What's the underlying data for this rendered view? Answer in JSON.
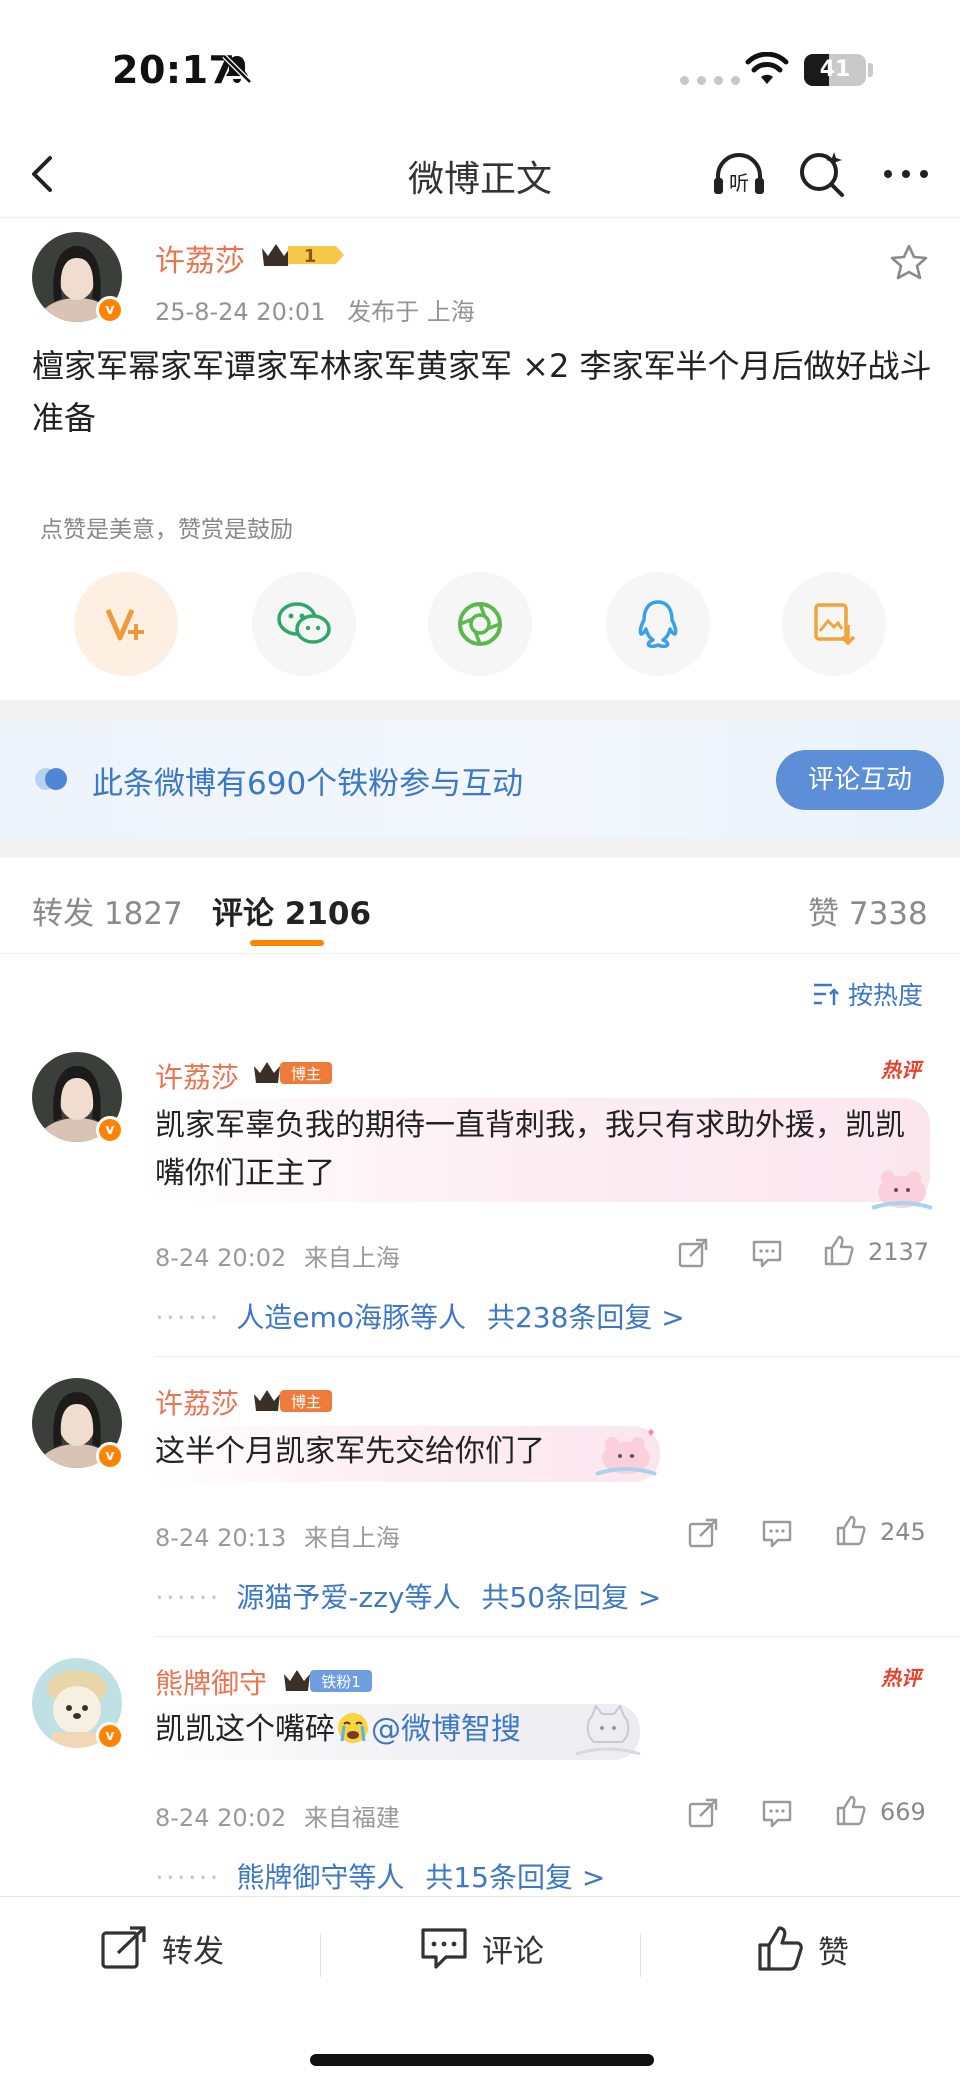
{
  "status_bar": {
    "time": "20:17",
    "battery": "41",
    "battery_level": 0.41
  },
  "nav": {
    "title": "微博正文"
  },
  "post": {
    "author": "许荔莎",
    "level": "1",
    "date": "25-8-24 20:01",
    "location": "发布于 上海",
    "text": "檀家军幂家军谭家军林家军黄家军 ×2 李家军半个月后做好战斗准备",
    "reward_hint": "点赞是美意，赞赏是鼓励"
  },
  "fans_banner": {
    "text": "此条微博有690个铁粉参与互动",
    "button": "评论互动"
  },
  "tabs": {
    "repost_label": "转发",
    "repost_count": "1827",
    "comment_label": "评论",
    "comment_count": "2106",
    "like_label": "赞",
    "like_count": "7338"
  },
  "sort": {
    "label": "按热度"
  },
  "comments": [
    {
      "author": "许荔莎",
      "badge": "博主",
      "hot": "热评",
      "text": "凯家军辜负我的期待一直背刺我，我只有求助外援，凯凯嘴你们正主了",
      "time": "8-24 20:02",
      "location": "来自上海",
      "likes": "2137",
      "replies_leader": "人造emo海豚等人",
      "replies_count": "共238条回复 >"
    },
    {
      "author": "许荔莎",
      "badge": "博主",
      "text": "这半个月凯家军先交给你们了",
      "time": "8-24 20:13",
      "location": "来自上海",
      "likes": "245",
      "replies_leader": "源猫予爱-zzy等人",
      "replies_count": "共50条回复 >"
    },
    {
      "author": "熊牌御守",
      "badge": "铁粉1",
      "hot": "热评",
      "text": "凯凯这个嘴碎",
      "mention": "@微博智搜",
      "time": "8-24 20:02",
      "location": "来自福建",
      "likes": "669",
      "replies_leader": "熊牌御守等人",
      "replies_count": "共15条回复 >"
    }
  ],
  "bottom_bar": {
    "repost": "转发",
    "comment": "评论",
    "like": "赞"
  },
  "colors": {
    "accent": "#ff8200",
    "name": "#eb7350",
    "link": "#3d78c6",
    "fans_button": "#5c8fd8"
  },
  "icons": [
    "bell-slash-icon",
    "wifi-icon",
    "back-icon",
    "listen-icon",
    "ai-search-icon",
    "more-icon",
    "star-icon",
    "reward-icon",
    "wechat-icon",
    "moments-icon",
    "qq-icon",
    "save-image-icon",
    "share-icon",
    "comment-icon",
    "like-icon"
  ]
}
